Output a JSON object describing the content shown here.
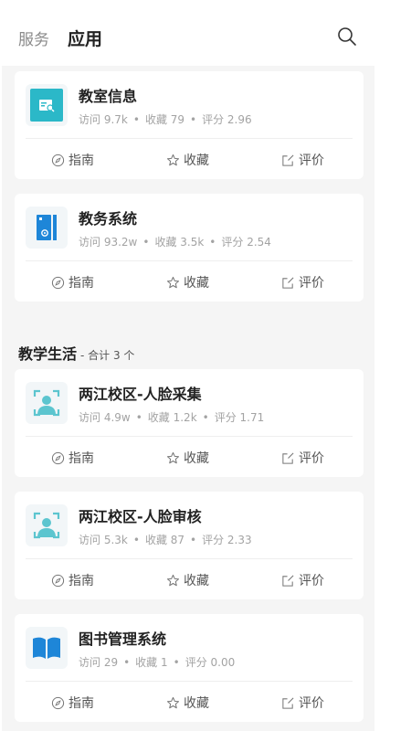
{
  "header": {
    "tab_services": "服务",
    "tab_apps": "应用"
  },
  "section": {
    "name": "教学生活",
    "count_label": "- 合计 3 个"
  },
  "actions": {
    "guide": "指南",
    "favorite": "收藏",
    "rate": "评价"
  },
  "apps": [
    {
      "name": "教室信息",
      "visits": "访问 9.7k",
      "favorites": "收藏 79",
      "rating": "评分 2.96",
      "icon": "classroom-info-icon"
    },
    {
      "name": "教务系统",
      "visits": "访问 93.2w",
      "favorites": "收藏 3.5k",
      "rating": "评分 2.54",
      "icon": "academic-system-icon"
    },
    {
      "name": "两江校区-人脸采集",
      "visits": "访问 4.9w",
      "favorites": "收藏 1.2k",
      "rating": "评分 1.71",
      "icon": "face-scan-icon"
    },
    {
      "name": "两江校区-人脸审核",
      "visits": "访问 5.3k",
      "favorites": "收藏 87",
      "rating": "评分 2.33",
      "icon": "face-scan-icon"
    },
    {
      "name": "图书管理系统",
      "visits": "访问 29",
      "favorites": "收藏 1",
      "rating": "评分 0.00",
      "icon": "book-icon"
    }
  ],
  "colors": {
    "teal": "#2bb8c8",
    "blue": "#1e86d8",
    "face": "#5cc5cf"
  }
}
